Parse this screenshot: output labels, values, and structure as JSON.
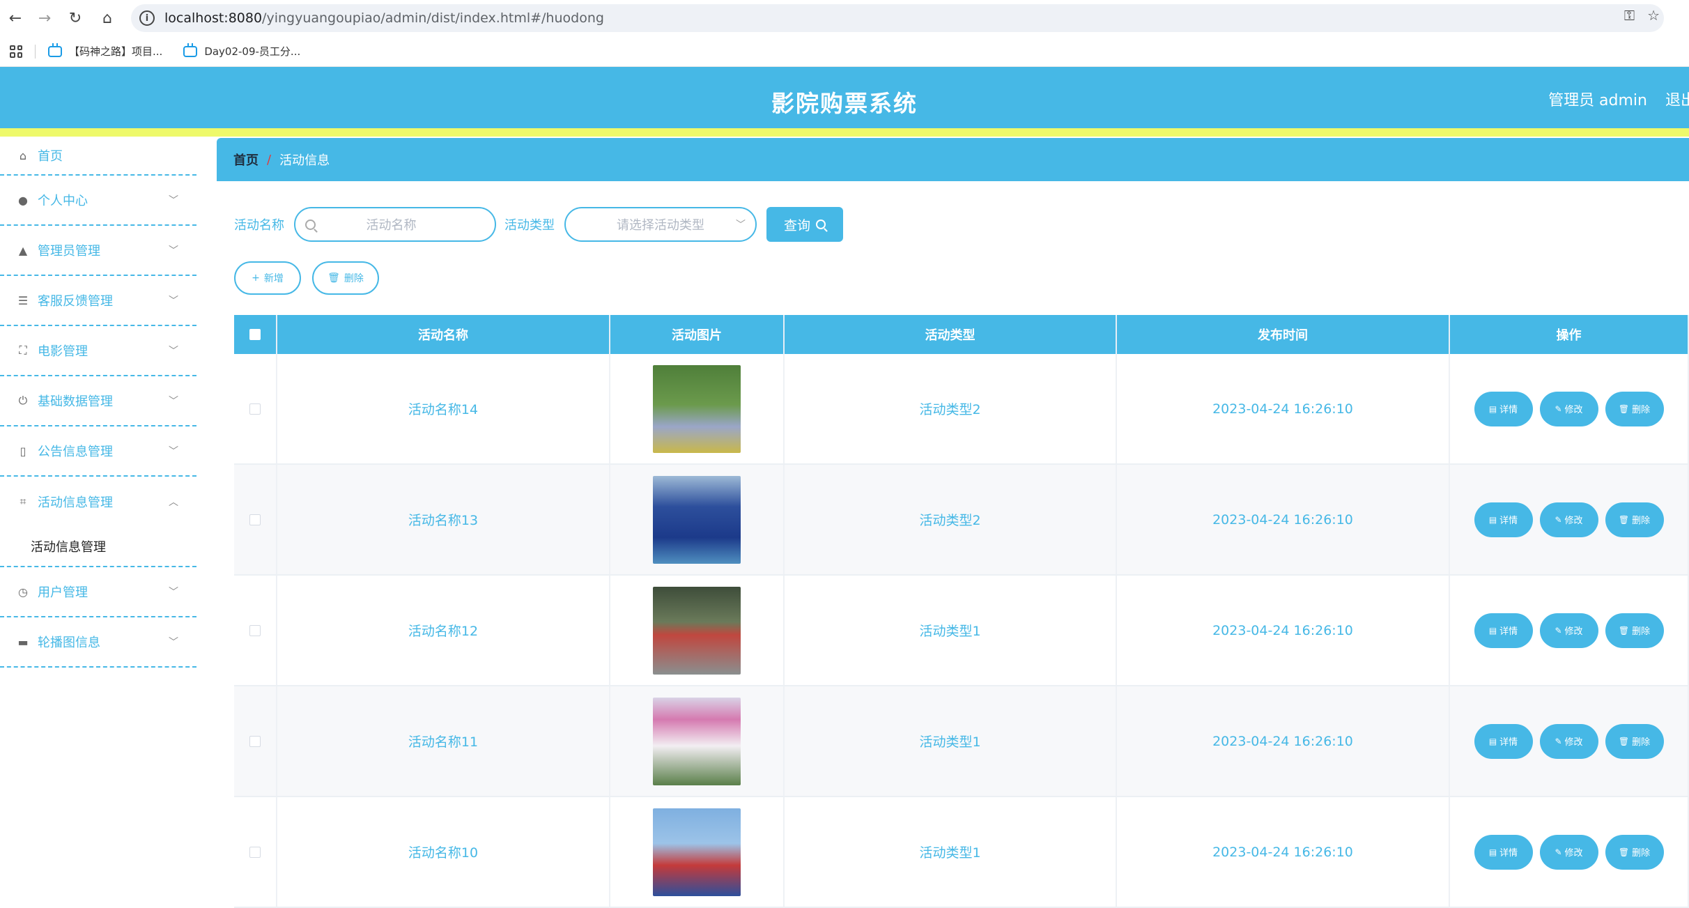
{
  "browser": {
    "url_host": "localhost:8080",
    "url_path": "/yingyuangoupiao/admin/dist/index.html#/huodong",
    "bookmarks": [
      {
        "label": "【码神之路】项目..."
      },
      {
        "label": "Day02-09-员工分..."
      }
    ]
  },
  "header": {
    "title": "影院购票系统",
    "user": "管理员 admin",
    "logout": "退出"
  },
  "sidebar": {
    "items": [
      {
        "label": "首页",
        "icon": "home-icon"
      },
      {
        "label": "个人中心",
        "icon": "user-icon"
      },
      {
        "label": "管理员管理",
        "icon": "admin-icon"
      },
      {
        "label": "客服反馈管理",
        "icon": "list-icon"
      },
      {
        "label": "电影管理",
        "icon": "fullscreen-icon"
      },
      {
        "label": "基础数据管理",
        "icon": "power-icon"
      },
      {
        "label": "公告信息管理",
        "icon": "mic-icon"
      },
      {
        "label": "活动信息管理",
        "icon": "crop-icon"
      },
      {
        "label": "用户管理",
        "icon": "clock-icon"
      },
      {
        "label": "轮播图信息",
        "icon": "chat-icon"
      }
    ],
    "submenu": "活动信息管理"
  },
  "breadcrumb": {
    "home": "首页",
    "separator": "/",
    "current": "活动信息"
  },
  "search": {
    "name_label": "活动名称",
    "name_placeholder": "活动名称",
    "type_label": "活动类型",
    "type_placeholder": "请选择活动类型",
    "query_button": "查询"
  },
  "actions": {
    "add": "新增",
    "delete": "删除"
  },
  "table": {
    "headers": [
      "活动名称",
      "活动图片",
      "活动类型",
      "发布时间",
      "操作"
    ],
    "rows": [
      {
        "name": "活动名称14",
        "type": "活动类型2",
        "time": "2023-04-24 16:26:10"
      },
      {
        "name": "活动名称13",
        "type": "活动类型2",
        "time": "2023-04-24 16:26:10"
      },
      {
        "name": "活动名称12",
        "type": "活动类型1",
        "time": "2023-04-24 16:26:10"
      },
      {
        "name": "活动名称11",
        "type": "活动类型1",
        "time": "2023-04-24 16:26:10"
      },
      {
        "name": "活动名称10",
        "type": "活动类型1",
        "time": "2023-04-24 16:26:10"
      }
    ],
    "op_labels": {
      "detail": "详情",
      "edit": "修改",
      "delete": "删除"
    }
  },
  "colors": {
    "accent": "#46b8e6",
    "strip": "#eef96a"
  }
}
